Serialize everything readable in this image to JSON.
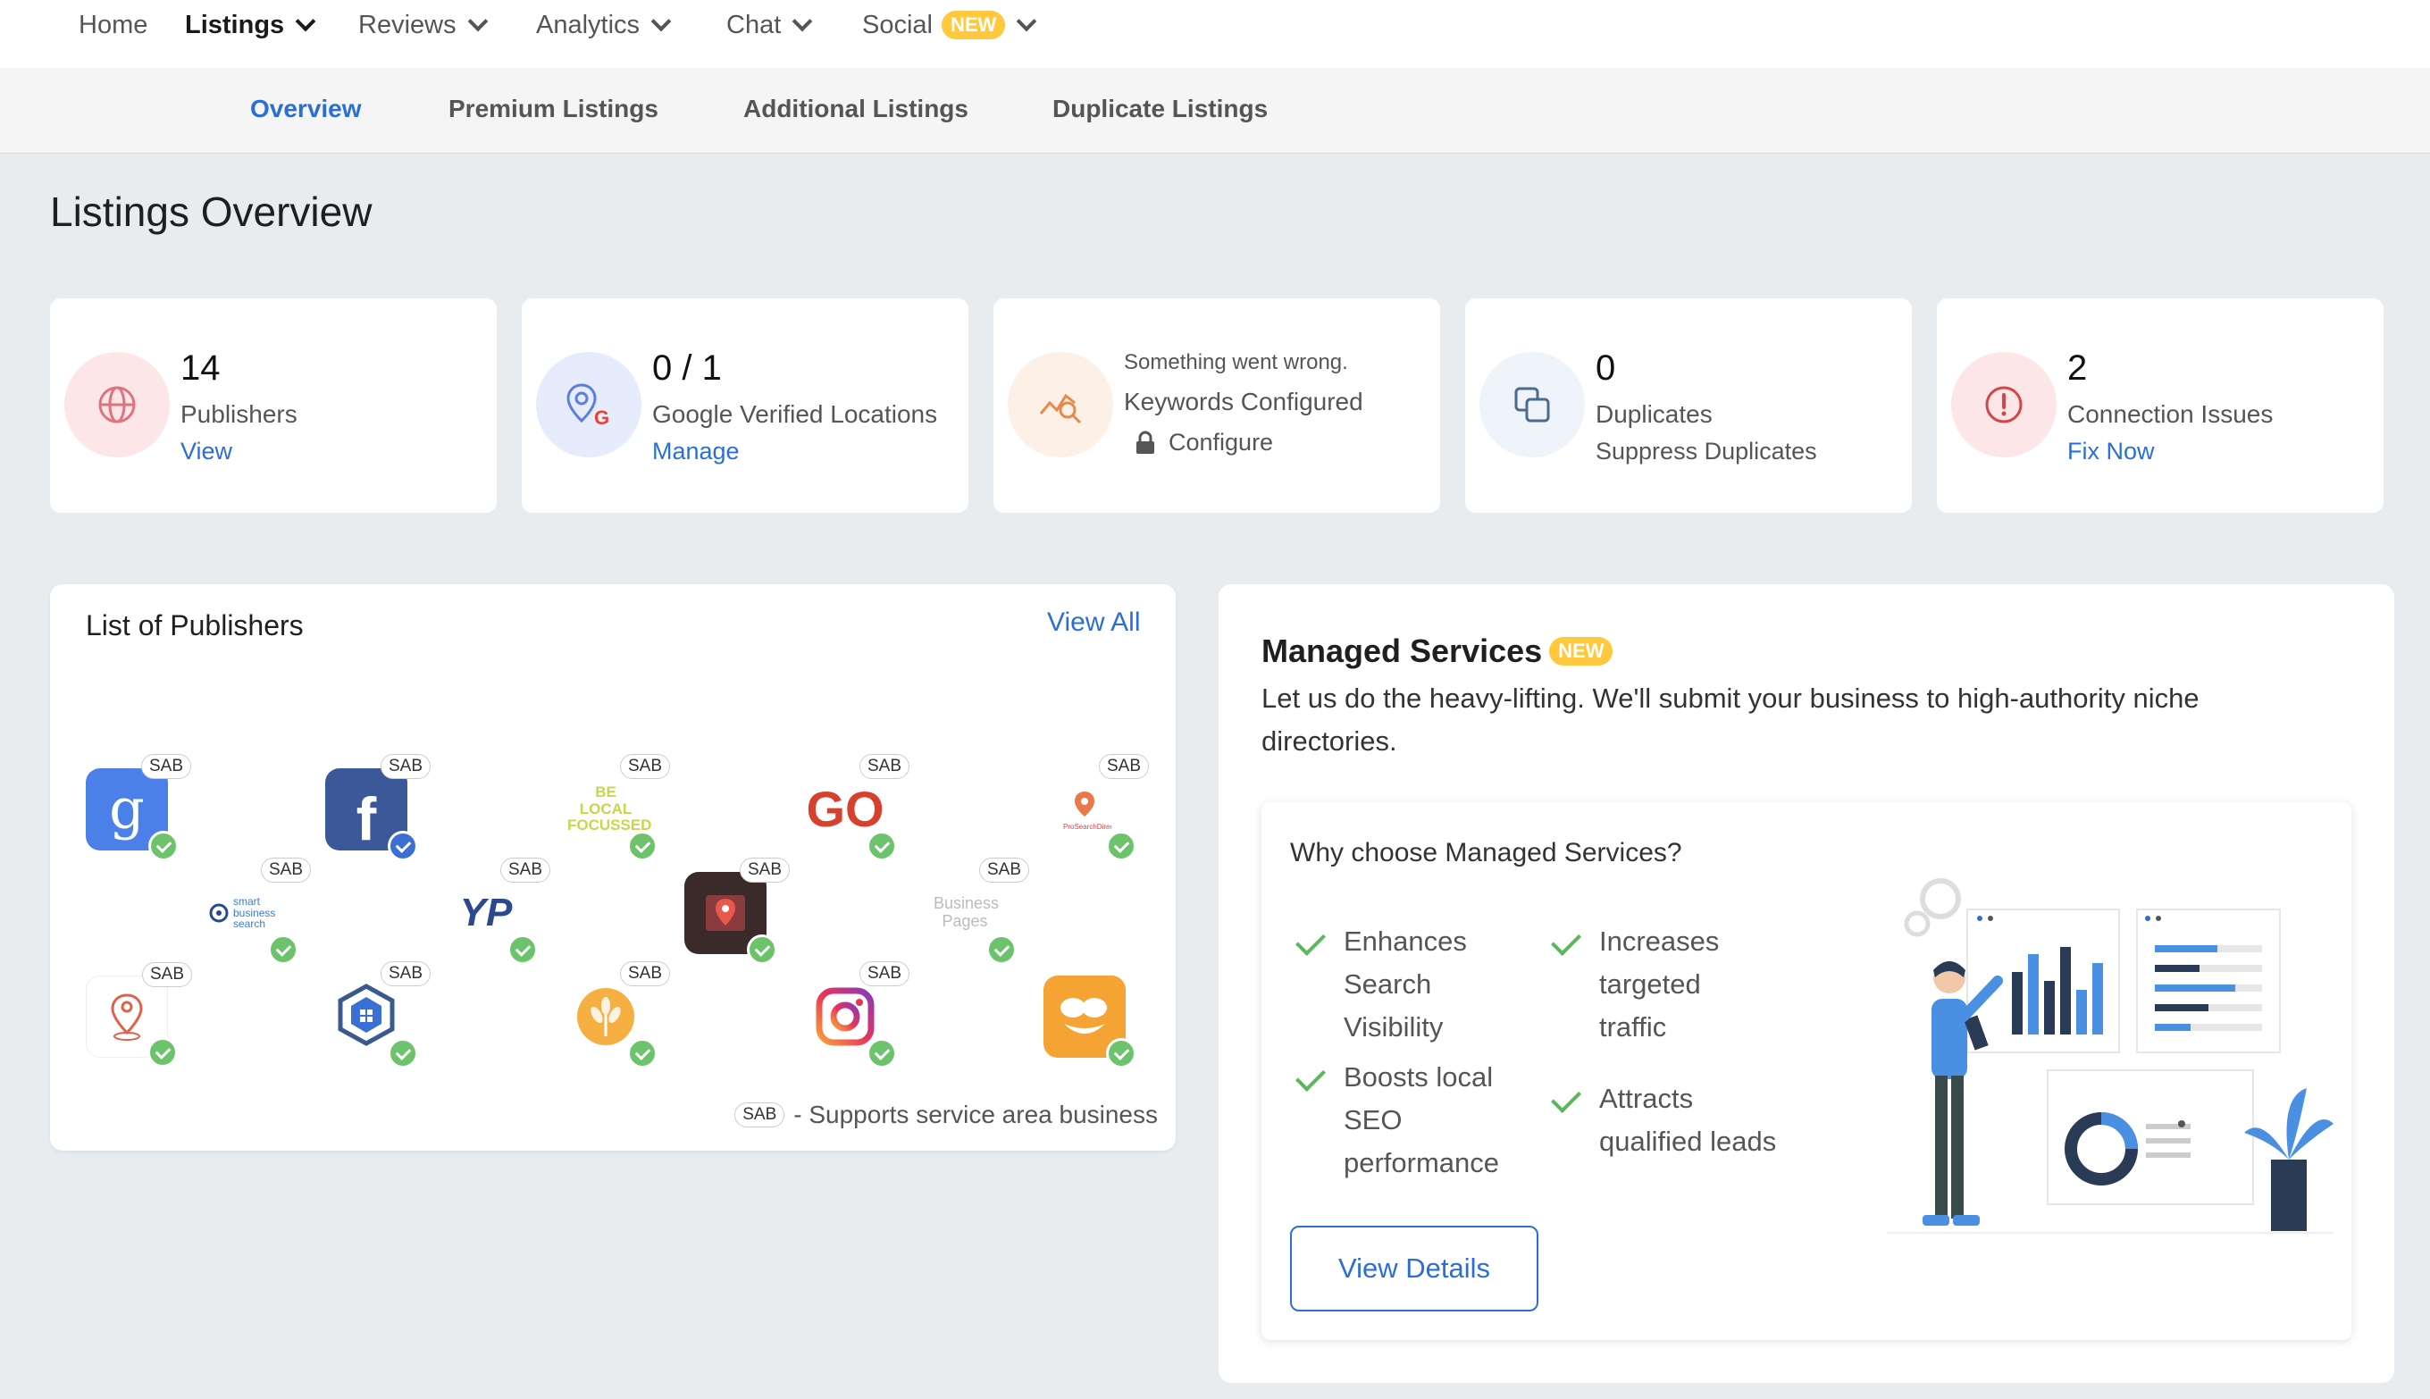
{
  "topnav": {
    "items": [
      {
        "label": "Home"
      },
      {
        "label": "Listings"
      },
      {
        "label": "Reviews"
      },
      {
        "label": "Analytics"
      },
      {
        "label": "Chat"
      },
      {
        "label": "Social"
      }
    ],
    "new_badge": "NEW"
  },
  "subnav": {
    "tabs": [
      "Overview",
      "Premium Listings",
      "Additional Listings",
      "Duplicate Listings"
    ]
  },
  "page": {
    "title": "Listings Overview"
  },
  "stats": {
    "publishers": {
      "value": "14",
      "label": "Publishers",
      "link": "View"
    },
    "google": {
      "value": "0 / 1",
      "label": "Google Verified Locations",
      "link": "Manage"
    },
    "keywords": {
      "error": "Something went wrong.",
      "label": "Keywords Configured",
      "action": "Configure"
    },
    "duplicates": {
      "value": "0",
      "label": "Duplicates",
      "sub": "Suppress Duplicates"
    },
    "connection": {
      "value": "2",
      "label": "Connection Issues",
      "link": "Fix Now"
    }
  },
  "publishers_panel": {
    "title": "List of Publishers",
    "view_all": "View All",
    "sab_chip": "SAB",
    "legend": "- Supports service area business",
    "logos": [
      {
        "icon": "google-my-business-icon",
        "sab": "SAB",
        "text": "g"
      },
      {
        "icon": "facebook-icon",
        "sab": "SAB",
        "text": "f"
      },
      {
        "icon": "be-local-focussed-icon",
        "sab": "SAB",
        "text": "BE LOCAL FOCUSSED"
      },
      {
        "icon": "golocalpages-icon",
        "sab": "SAB",
        "text": "GO"
      },
      {
        "icon": "prosearch-directory-icon",
        "sab": "SAB",
        "text": "ProSearchDirectory"
      },
      {
        "icon": "smart-business-search-icon",
        "sab": "SAB",
        "text": "smart business search"
      },
      {
        "icon": "yp-listing-icon",
        "sab": "SAB",
        "text": "YP"
      },
      {
        "icon": "local-map-icon",
        "sab": "SAB",
        "text": ""
      },
      {
        "icon": "business-pages-icon",
        "sab": "SAB",
        "text": "Business Pages"
      },
      {
        "icon": "locator-pin-icon",
        "sab": "SAB",
        "text": ""
      },
      {
        "icon": "hex-directory-icon",
        "sab": "SAB",
        "text": ""
      },
      {
        "icon": "wheat-directory-icon",
        "sab": "SAB",
        "text": ""
      },
      {
        "icon": "instagram-icon",
        "sab": "SAB",
        "text": ""
      },
      {
        "icon": "swarm-icon",
        "sab": "",
        "text": ""
      }
    ]
  },
  "managed_services": {
    "title": "Managed Services",
    "new_badge": "NEW",
    "description": "Let us do the heavy-lifting. We'll submit your business to high-authority niche directories.",
    "why_title": "Why choose Managed Services?",
    "benefits": [
      "Enhances Search Visibility",
      "Increases targeted traffic",
      "Boosts local SEO performance",
      "Attracts qualified leads"
    ],
    "button": "View Details"
  },
  "colors": {
    "accent": "#2b6fd6",
    "badge": "#ffc83d",
    "check": "#6cc36b"
  }
}
